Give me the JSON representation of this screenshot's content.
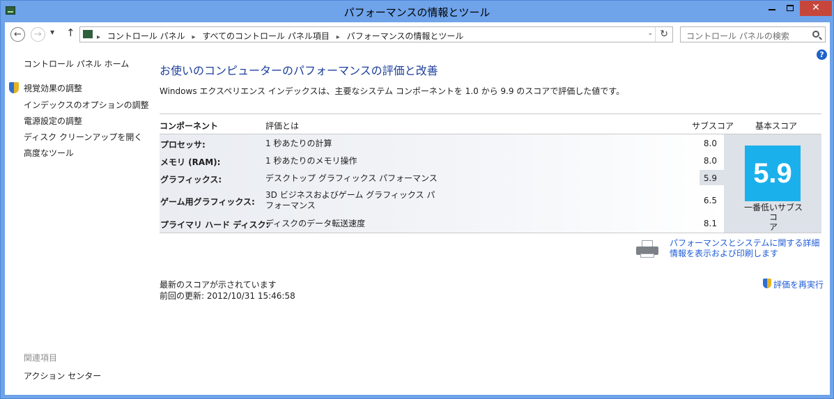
{
  "window": {
    "title": "パフォーマンスの情報とツール",
    "min_glyph": "",
    "close_glyph": "✕"
  },
  "nav": {
    "back": "←",
    "forward": "→",
    "history": "▼",
    "up": "↑",
    "breadcrumbs": [
      "コントロール パネル",
      "すべてのコントロール パネル項目",
      "パフォーマンスの情報とツール"
    ],
    "separator": "▸",
    "dropdown": "⌄",
    "refresh": "↻"
  },
  "search": {
    "placeholder": "コントロール パネルの検索"
  },
  "sidebar": {
    "home": "コントロール パネル ホーム",
    "items": [
      {
        "label": "視覚効果の調整"
      },
      {
        "label": "インデックスのオプションの調整"
      },
      {
        "label": "電源設定の調整"
      },
      {
        "label": "ディスク クリーンアップを開く"
      },
      {
        "label": "高度なツール"
      }
    ],
    "related_heading": "関連項目",
    "related_items": [
      {
        "label": "アクション センター"
      }
    ]
  },
  "help": {
    "glyph": "?"
  },
  "main": {
    "heading": "お使いのコンピューターのパフォーマンスの評価と改善",
    "intro": "Windows エクスペリエンス インデックスは、主要なシステム コンポーネントを 1.0 から 9.9 のスコアで評価した値です。",
    "table": {
      "headers": {
        "component": "コンポーネント",
        "rating": "評価とは",
        "subscore": "サブスコア",
        "base": "基本スコア"
      },
      "rows": [
        {
          "component": "プロセッサ:",
          "description": "1 秒あたりの計算",
          "subscore": "8.0"
        },
        {
          "component": "メモリ (RAM):",
          "description": "1 秒あたりのメモリ操作",
          "subscore": "8.0"
        },
        {
          "component": "グラフィックス:",
          "description": "デスクトップ グラフィックス パフォーマンス",
          "subscore": "5.9"
        },
        {
          "component": "ゲーム用グラフィックス:",
          "description_line1": "3D ビジネスおよびゲーム グラフィックス パ",
          "description_line2": "フォーマンス",
          "subscore": "6.5"
        },
        {
          "component": "プライマリ ハード ディスク:",
          "description": "ディスクのデータ転送速度",
          "subscore": "8.1"
        }
      ],
      "base_score": "5.9",
      "base_caption_line1": "一番低いサブスコ",
      "base_caption_line2": "ア"
    },
    "details_link": "パフォーマンスとシステムに関する詳細情報を表示および印刷します",
    "latest_text": "最新のスコアが示されています",
    "updated_text": "前回の更新: 2012/10/31 15:46:58",
    "rerun_link": "評価を再実行"
  },
  "colors": {
    "titlebar": "#6fa3ea",
    "close_button": "#c7463b",
    "heading": "#1d3f9b",
    "link": "#1d5bd8",
    "score_tile": "#1ab0ec"
  }
}
